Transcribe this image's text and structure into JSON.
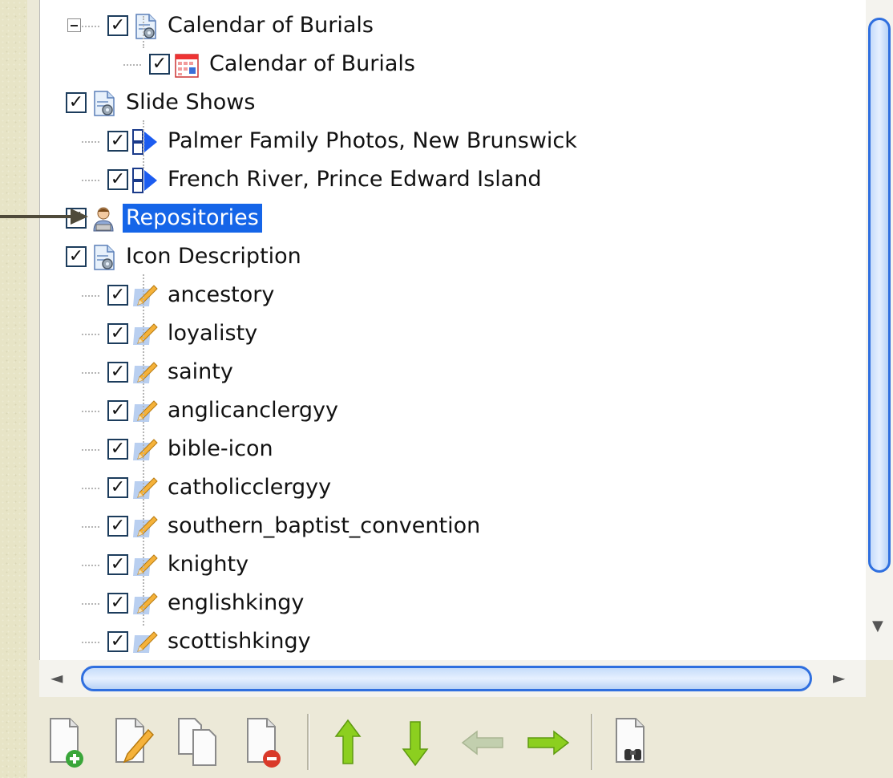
{
  "tree": {
    "items": [
      {
        "label": "Calendar of Burials",
        "level": 1,
        "expander": true,
        "icon": "report-gear-icon",
        "checked": true
      },
      {
        "label": "Calendar of Burials",
        "level": 2,
        "expander": false,
        "icon": "calendar-icon",
        "checked": true
      },
      {
        "label": "Slide Shows",
        "level": 0,
        "expander": true,
        "icon": "report-gear-icon",
        "checked": true
      },
      {
        "label": "Palmer Family Photos, New Brunswick",
        "level": 1,
        "expander": false,
        "icon": "slideshow-icon",
        "checked": true
      },
      {
        "label": "French River, Prince Edward Island",
        "level": 1,
        "expander": false,
        "icon": "slideshow-icon",
        "checked": true
      },
      {
        "label": "Repositories",
        "level": 0,
        "expander": false,
        "icon": "person-icon",
        "checked": true,
        "selected": true
      },
      {
        "label": "Icon Description",
        "level": 0,
        "expander": true,
        "icon": "report-gear-icon",
        "checked": true
      },
      {
        "label": "ancestory",
        "level": 1,
        "expander": false,
        "icon": "pencil-note-icon",
        "checked": true
      },
      {
        "label": "loyalisty",
        "level": 1,
        "expander": false,
        "icon": "pencil-note-icon",
        "checked": true
      },
      {
        "label": "sainty",
        "level": 1,
        "expander": false,
        "icon": "pencil-note-icon",
        "checked": true
      },
      {
        "label": "anglicanclergyy",
        "level": 1,
        "expander": false,
        "icon": "pencil-note-icon",
        "checked": true
      },
      {
        "label": "bible-icon",
        "level": 1,
        "expander": false,
        "icon": "pencil-note-icon",
        "checked": true
      },
      {
        "label": "catholicclergyy",
        "level": 1,
        "expander": false,
        "icon": "pencil-note-icon",
        "checked": true
      },
      {
        "label": "southern_baptist_convention",
        "level": 1,
        "expander": false,
        "icon": "pencil-note-icon",
        "checked": true
      },
      {
        "label": "knighty",
        "level": 1,
        "expander": false,
        "icon": "pencil-note-icon",
        "checked": true
      },
      {
        "label": "englishkingy",
        "level": 1,
        "expander": false,
        "icon": "pencil-note-icon",
        "checked": true
      },
      {
        "label": "scottishkingy",
        "level": 1,
        "expander": false,
        "icon": "pencil-note-icon",
        "checked": true
      }
    ]
  },
  "toolbar": {
    "buttons": [
      {
        "name": "add-item-button",
        "icon": "new-page-plus-icon"
      },
      {
        "name": "edit-item-button",
        "icon": "edit-page-pencil-icon"
      },
      {
        "name": "copy-item-button",
        "icon": "copy-pages-icon"
      },
      {
        "name": "delete-item-button",
        "icon": "page-minus-icon"
      },
      {
        "name": "move-up-button",
        "icon": "arrow-up-icon"
      },
      {
        "name": "move-down-button",
        "icon": "arrow-down-icon"
      },
      {
        "name": "move-left-button",
        "icon": "arrow-left-icon",
        "disabled": true
      },
      {
        "name": "move-right-button",
        "icon": "arrow-right-icon"
      },
      {
        "name": "find-button",
        "icon": "binoculars-page-icon"
      }
    ]
  },
  "colors": {
    "selection": "#1565e8",
    "scroll_thumb": "#2f6fdf",
    "arrow_green": "#7fc21b",
    "arrow_disabled": "#b9c7a4",
    "annotation_arrow": "#4f4a3a"
  }
}
